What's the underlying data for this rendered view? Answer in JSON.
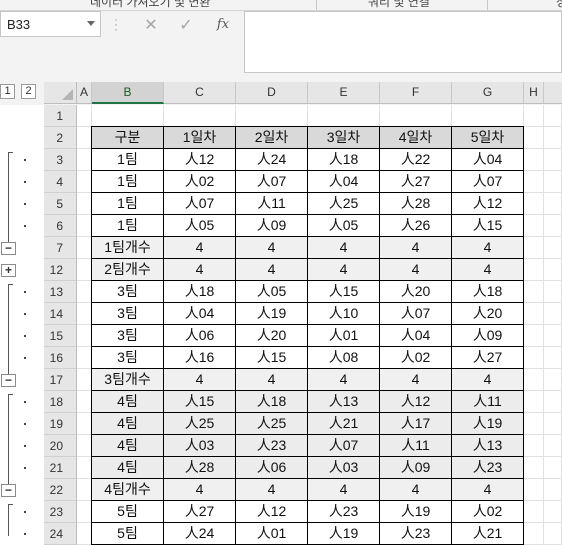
{
  "ribbon": {
    "group1": "데이터 가져오기 및 변환",
    "group2": "쿼리 및 연결",
    "group3": "정"
  },
  "formula_bar": {
    "name_box": "B33",
    "cancel_icon": "✕",
    "enter_icon": "✓",
    "fx_label": "fx",
    "formula": ""
  },
  "outline_levels": [
    "1",
    "2"
  ],
  "columns": [
    "A",
    "B",
    "C",
    "D",
    "E",
    "F",
    "G",
    "H"
  ],
  "selected_column": "B",
  "rows": [
    {
      "num": "1",
      "cells": [
        "",
        "",
        "",
        "",
        "",
        ""
      ],
      "style": "empty"
    },
    {
      "num": "2",
      "cells": [
        "구분",
        "1일차",
        "2일차",
        "3일차",
        "4일차",
        "5일차"
      ],
      "style": "hdr"
    },
    {
      "num": "3",
      "cells": [
        "1팀",
        "人12",
        "人24",
        "人18",
        "人22",
        "人04"
      ],
      "style": "data"
    },
    {
      "num": "4",
      "cells": [
        "1팀",
        "人02",
        "人07",
        "人04",
        "人27",
        "人07"
      ],
      "style": "data"
    },
    {
      "num": "5",
      "cells": [
        "1팀",
        "人07",
        "人11",
        "人25",
        "人28",
        "人12"
      ],
      "style": "data"
    },
    {
      "num": "6",
      "cells": [
        "1팀",
        "人05",
        "人09",
        "人05",
        "人26",
        "人15"
      ],
      "style": "data"
    },
    {
      "num": "7",
      "cells": [
        "1팀개수",
        "4",
        "4",
        "4",
        "4",
        "4"
      ],
      "style": "sub"
    },
    {
      "num": "12",
      "cells": [
        "2팀개수",
        "4",
        "4",
        "4",
        "4",
        "4"
      ],
      "style": "sub"
    },
    {
      "num": "13",
      "cells": [
        "3팀",
        "人18",
        "人05",
        "人15",
        "人20",
        "人18"
      ],
      "style": "data"
    },
    {
      "num": "14",
      "cells": [
        "3팀",
        "人04",
        "人19",
        "人10",
        "人07",
        "人20"
      ],
      "style": "data"
    },
    {
      "num": "15",
      "cells": [
        "3팀",
        "人06",
        "人20",
        "人01",
        "人04",
        "人09"
      ],
      "style": "data"
    },
    {
      "num": "16",
      "cells": [
        "3팀",
        "人16",
        "人15",
        "人08",
        "人02",
        "人27"
      ],
      "style": "data"
    },
    {
      "num": "17",
      "cells": [
        "3팀개수",
        "4",
        "4",
        "4",
        "4",
        "4"
      ],
      "style": "sub"
    },
    {
      "num": "18",
      "cells": [
        "4팀",
        "人15",
        "人18",
        "人13",
        "人12",
        "人11"
      ],
      "style": "grey"
    },
    {
      "num": "19",
      "cells": [
        "4팀",
        "人25",
        "人25",
        "人21",
        "人17",
        "人19"
      ],
      "style": "grey"
    },
    {
      "num": "20",
      "cells": [
        "4팀",
        "人03",
        "人23",
        "人07",
        "人11",
        "人13"
      ],
      "style": "grey"
    },
    {
      "num": "21",
      "cells": [
        "4팀",
        "人28",
        "人06",
        "人03",
        "人09",
        "人23"
      ],
      "style": "grey"
    },
    {
      "num": "22",
      "cells": [
        "4팀개수",
        "4",
        "4",
        "4",
        "4",
        "4"
      ],
      "style": "sub"
    },
    {
      "num": "23",
      "cells": [
        "5팀",
        "人27",
        "人12",
        "人23",
        "人19",
        "人02"
      ],
      "style": "data"
    },
    {
      "num": "24",
      "cells": [
        "5팀",
        "人24",
        "人01",
        "人19",
        "人23",
        "人21"
      ],
      "style": "data"
    }
  ],
  "outline_buttons": {
    "collapse": "−",
    "expand": "+"
  }
}
